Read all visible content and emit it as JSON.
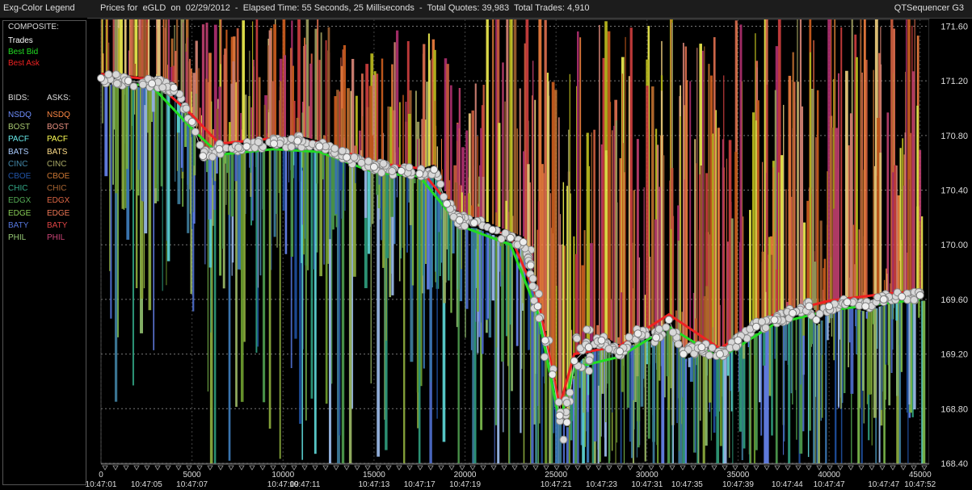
{
  "header": {
    "legend_title": "Exg-Color Legend",
    "chart_title": "Prices for  eGLD  on  02/29/2012  -  Elapsed Time: 55 Seconds, 25 Milliseconds  -  Total Quotes: 39,983  Total Trades: 4,910",
    "app_name": "QTSequencer G3"
  },
  "legend": {
    "composite_label": "COMPOSITE:",
    "composite": [
      {
        "label": "Trades",
        "color": "#ffffff"
      },
      {
        "label": "Best Bid",
        "color": "#22dd22"
      },
      {
        "label": "Best Ask",
        "color": "#ee2222"
      }
    ],
    "bids_label": "BIDS:",
    "asks_label": "ASKS:",
    "exchanges": [
      {
        "bid": "NSDQ",
        "ask": "NSDQ",
        "bid_color": "#6f8fff",
        "ask_color": "#ff8844"
      },
      {
        "bid": "BOST",
        "ask": "BOST",
        "bid_color": "#a8c870",
        "ask_color": "#e89080"
      },
      {
        "bid": "PACF",
        "ask": "PACF",
        "bid_color": "#66e8e8",
        "ask_color": "#ffff55"
      },
      {
        "bid": "BATS",
        "ask": "BATS",
        "bid_color": "#aaccff",
        "ask_color": "#ffdd88"
      },
      {
        "bid": "CINC",
        "ask": "CINC",
        "bid_color": "#4488aa",
        "ask_color": "#aaaa66"
      },
      {
        "bid": "CBOE",
        "ask": "CBOE",
        "bid_color": "#2255aa",
        "ask_color": "#cc7733"
      },
      {
        "bid": "CHIC",
        "ask": "CHIC",
        "bid_color": "#33aa88",
        "ask_color": "#aa6633"
      },
      {
        "bid": "EDGX",
        "ask": "EDGX",
        "bid_color": "#55aa55",
        "ask_color": "#dd6644"
      },
      {
        "bid": "EDGE",
        "ask": "EDGE",
        "bid_color": "#88cc55",
        "ask_color": "#ee7755"
      },
      {
        "bid": "BATY",
        "ask": "BATY",
        "bid_color": "#5577dd",
        "ask_color": "#dd4444"
      },
      {
        "bid": "PHIL",
        "ask": "PHIL",
        "bid_color": "#99cc77",
        "ask_color": "#cc4477"
      }
    ]
  },
  "chart_data": {
    "type": "line",
    "xlabel": "",
    "ylabel": "",
    "xlim": [
      0,
      45500
    ],
    "ylim": [
      168.4,
      171.65
    ],
    "y_ticks": [
      171.6,
      171.2,
      170.8,
      170.4,
      170.0,
      169.6,
      169.2,
      168.8,
      168.4
    ],
    "x_ticks": [
      {
        "v": 0,
        "seq": "0",
        "time": "10:47:01"
      },
      {
        "v": 5000,
        "seq": "5000",
        "time": "10:47:07"
      },
      {
        "v": 10000,
        "seq": "10000",
        "time": "10:47:09"
      },
      {
        "v": 15000,
        "seq": "15000",
        "time": "10:47:13"
      },
      {
        "v": 20000,
        "seq": "20000",
        "time": "10:47:19"
      },
      {
        "v": 25000,
        "seq": "25000",
        "time": "10:47:21"
      },
      {
        "v": 30000,
        "seq": "30000",
        "time": "10:47:31"
      },
      {
        "v": 35000,
        "seq": "35000",
        "time": "10:47:39"
      },
      {
        "v": 40000,
        "seq": "40000",
        "time": "10:47:47"
      },
      {
        "v": 45000,
        "seq": "45000",
        "time": "10:47:52"
      }
    ],
    "minor_times": [
      {
        "v": 2500,
        "time": "10:47:05"
      },
      {
        "v": 11200,
        "time": "10:47:11"
      },
      {
        "v": 17500,
        "time": "10:47:17"
      },
      {
        "v": 27500,
        "time": "10:47:23"
      },
      {
        "v": 32200,
        "time": "10:47:35"
      },
      {
        "v": 37700,
        "time": "10:47:44"
      },
      {
        "v": 43000,
        "time": "10:47:47"
      }
    ],
    "grid": true,
    "series": [
      {
        "name": "Trades",
        "color": "#ffffff",
        "x": [
          0,
          1500,
          2800,
          4000,
          5000,
          5600,
          6500,
          8000,
          9500,
          10800,
          12000,
          13500,
          15000,
          16500,
          17500,
          18300,
          19000,
          19700,
          20500,
          21500,
          22500,
          23200,
          23600,
          24000,
          24400,
          24800,
          25200,
          25600,
          26000,
          26800,
          27500,
          28500,
          29500,
          30500,
          31200,
          32000,
          33000,
          34000,
          35000,
          36000,
          37000,
          38000,
          38900,
          39300,
          40000,
          41000,
          42000,
          43000,
          44000,
          45000
        ],
        "y": [
          171.22,
          171.2,
          171.18,
          171.15,
          170.9,
          170.65,
          170.7,
          170.72,
          170.74,
          170.76,
          170.72,
          170.64,
          170.57,
          170.54,
          170.52,
          170.55,
          170.3,
          170.18,
          170.16,
          170.11,
          170.05,
          170.02,
          169.85,
          169.55,
          169.3,
          169.05,
          168.75,
          168.7,
          169.15,
          169.25,
          169.3,
          169.22,
          169.35,
          169.32,
          169.45,
          169.2,
          169.25,
          169.2,
          169.3,
          169.4,
          169.45,
          169.5,
          169.55,
          169.45,
          169.55,
          169.58,
          169.55,
          169.6,
          169.62,
          169.63
        ]
      },
      {
        "name": "Best Bid",
        "color": "#22dd22",
        "x": [
          0,
          2800,
          5000,
          6500,
          9500,
          12000,
          15000,
          17500,
          19700,
          22500,
          24000,
          25200,
          26000,
          28500,
          31200,
          34000,
          37000,
          40000,
          43000,
          45000
        ],
        "y": [
          171.2,
          171.16,
          170.85,
          170.66,
          170.7,
          170.68,
          170.53,
          170.5,
          170.14,
          170.0,
          169.5,
          168.7,
          169.1,
          169.18,
          169.4,
          169.17,
          169.42,
          169.52,
          169.57,
          169.6
        ]
      },
      {
        "name": "Best Ask",
        "color": "#ee2222",
        "x": [
          0,
          2800,
          5000,
          6500,
          9500,
          12000,
          15000,
          17500,
          19700,
          22500,
          24000,
          25200,
          26000,
          28500,
          31200,
          34000,
          37000,
          40000,
          43000,
          45000
        ],
        "y": [
          171.25,
          171.21,
          170.95,
          170.74,
          170.78,
          170.75,
          170.6,
          170.56,
          170.2,
          170.06,
          169.6,
          168.82,
          169.2,
          169.26,
          169.49,
          169.24,
          169.49,
          169.59,
          169.64,
          169.66
        ]
      }
    ]
  }
}
